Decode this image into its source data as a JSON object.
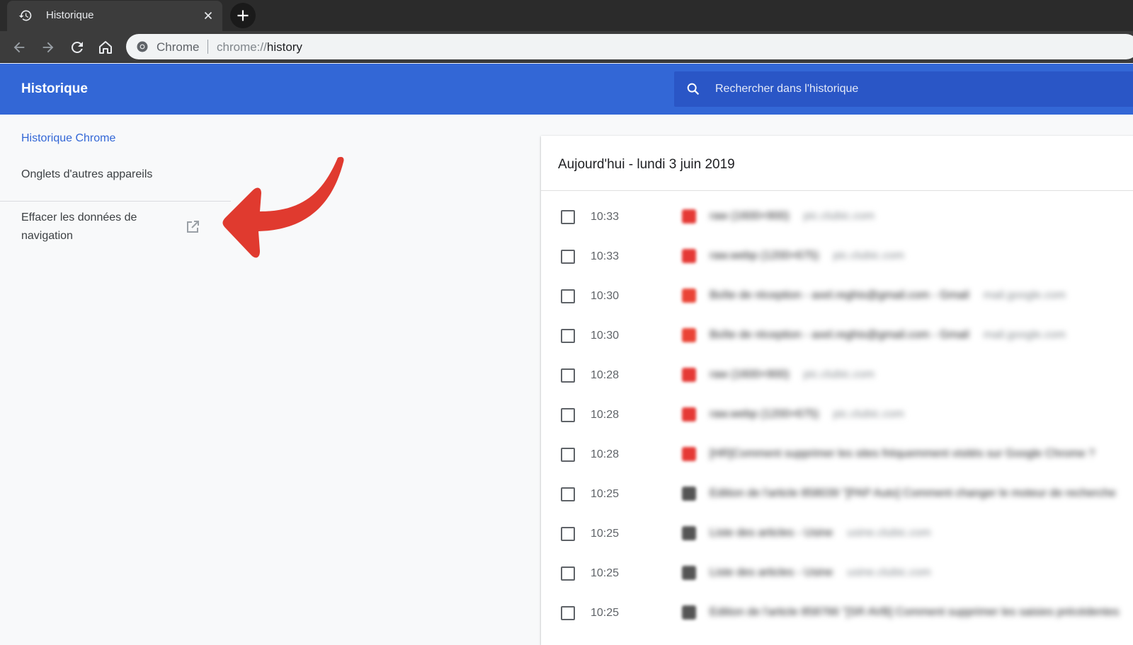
{
  "browser": {
    "tab_title": "Historique",
    "site_label": "Chrome",
    "url_scheme": "chrome://",
    "url_path": "history"
  },
  "header": {
    "title": "Historique",
    "search_placeholder": "Rechercher dans l'historique",
    "color": "#3367d6"
  },
  "sidebar": {
    "items": [
      {
        "label": "Historique Chrome",
        "selected": true
      },
      {
        "label": "Onglets d'autres appareils",
        "selected": false
      }
    ],
    "clear_data_label": "Effacer les données de navigation"
  },
  "history": {
    "date_heading": "Aujourd'hui - lundi 3 juin 2019",
    "entries": [
      {
        "time": "10:33",
        "title": "raw (1600×900)",
        "domain": "pic.clubic.com",
        "favicon_color": "#e53935"
      },
      {
        "time": "10:33",
        "title": "raw.webp (1200×675)",
        "domain": "pic.clubic.com",
        "favicon_color": "#e53935"
      },
      {
        "time": "10:30",
        "title": "Boîte de réception - axel.reghis@gmail.com - Gmail",
        "domain": "mail.google.com",
        "favicon_color": "#ea4335"
      },
      {
        "time": "10:30",
        "title": "Boîte de réception - axel.reghis@gmail.com - Gmail",
        "domain": "mail.google.com",
        "favicon_color": "#ea4335"
      },
      {
        "time": "10:28",
        "title": "raw (1600×900)",
        "domain": "pic.clubic.com",
        "favicon_color": "#e53935"
      },
      {
        "time": "10:28",
        "title": "raw.webp (1200×675)",
        "domain": "pic.clubic.com",
        "favicon_color": "#e53935"
      },
      {
        "time": "10:28",
        "title": "[HR]Comment supprimer les sites fréquemment visités sur Google Chrome ?",
        "domain": "",
        "favicon_color": "#e53935"
      },
      {
        "time": "10:25",
        "title": "Edition de l'article 858039 \"[PAP Auto] Comment changer le moteur de recherche",
        "domain": "",
        "favicon_color": "#555555"
      },
      {
        "time": "10:25",
        "title": "Liste des articles - Usine",
        "domain": "usine.clubic.com",
        "favicon_color": "#555555"
      },
      {
        "time": "10:25",
        "title": "Liste des articles - Usine",
        "domain": "usine.clubic.com",
        "favicon_color": "#555555"
      },
      {
        "time": "10:25",
        "title": "Edition de l'article 858766 \"[SR AVB] Comment supprimer les saisies précédentes",
        "domain": "",
        "favicon_color": "#555555"
      }
    ]
  },
  "annotation": {
    "arrow_color": "#e03a2f"
  }
}
